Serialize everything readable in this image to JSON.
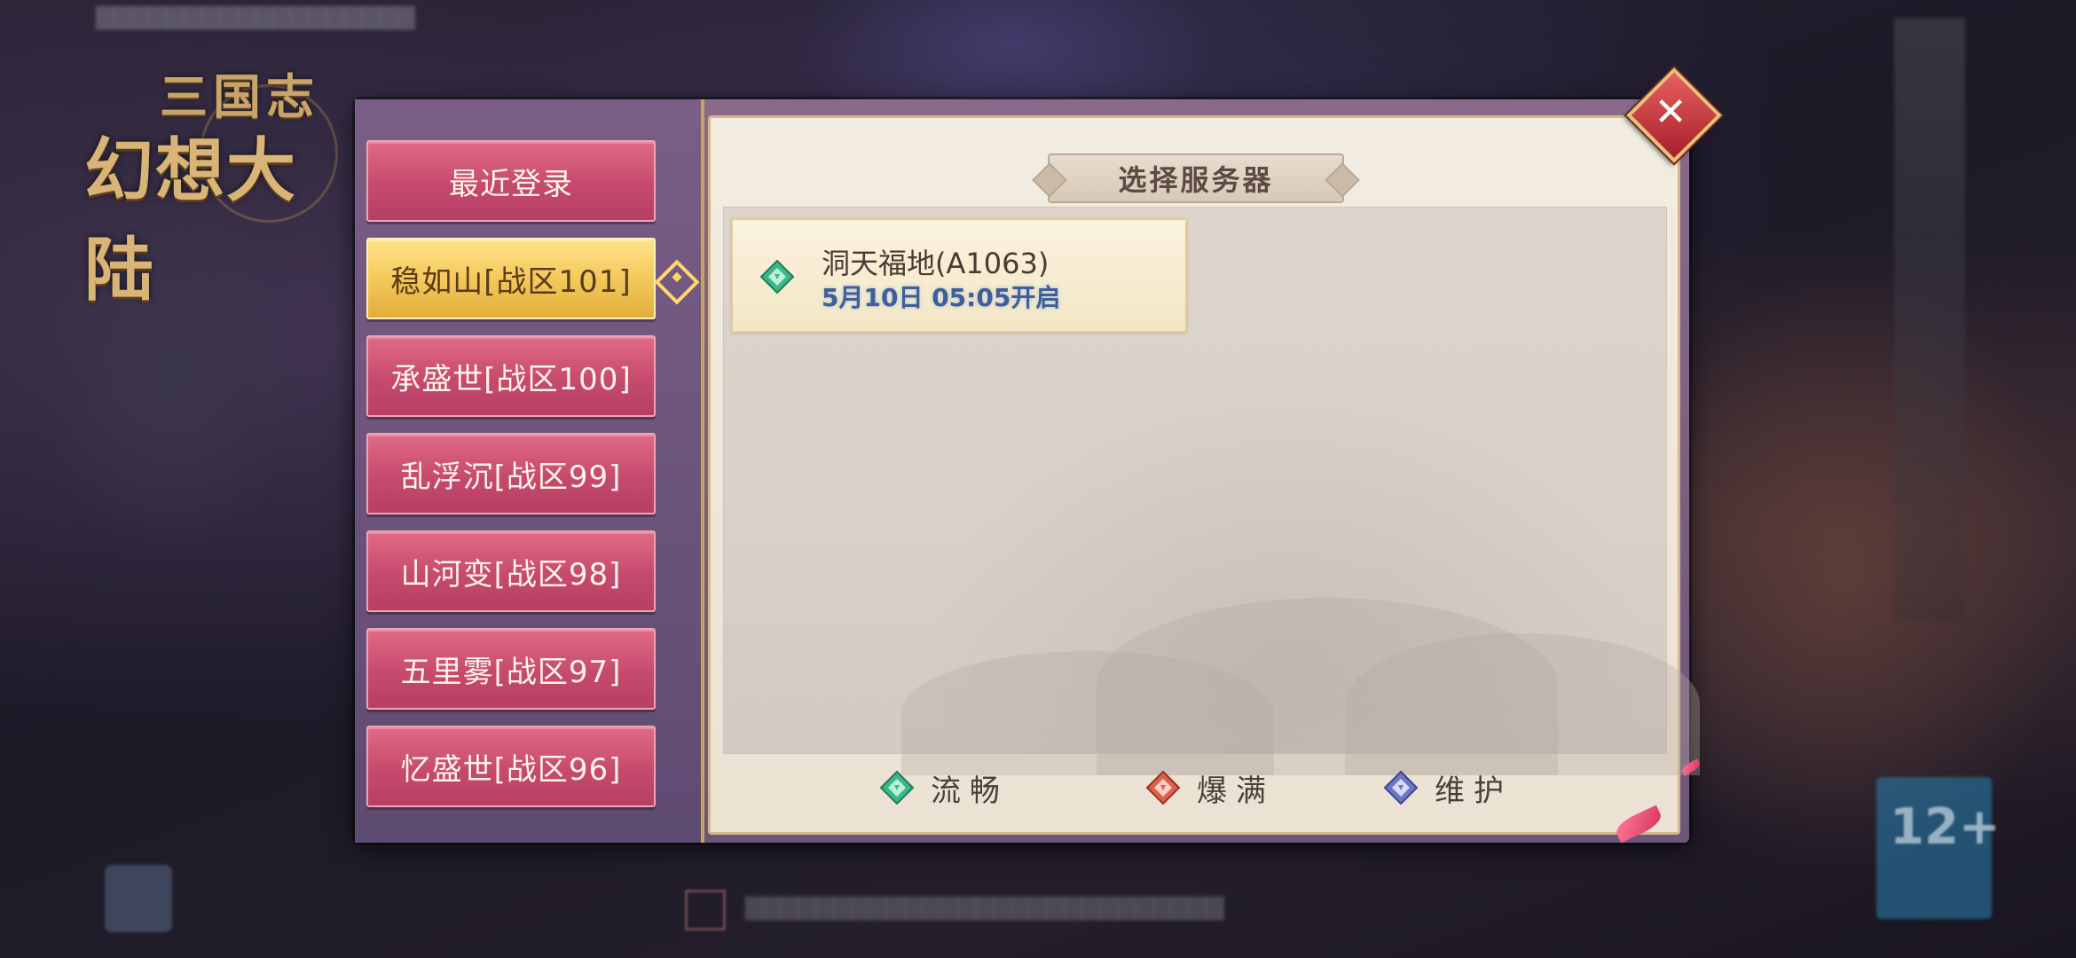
{
  "background": {
    "logo_line1": "三国志",
    "logo_line2": "幻想大陆",
    "age_rating": "12+"
  },
  "dialog": {
    "title": "选择服务器",
    "close_icon": "close-icon",
    "tabs": [
      {
        "label": "最近登录",
        "active": false
      },
      {
        "label": "稳如山[战区101]",
        "active": true
      },
      {
        "label": "承盛世[战区100]",
        "active": false
      },
      {
        "label": "乱浮沉[战区99]",
        "active": false
      },
      {
        "label": "山河变[战区98]",
        "active": false
      },
      {
        "label": "五里雾[战区97]",
        "active": false
      },
      {
        "label": "忆盛世[战区96]",
        "active": false
      }
    ],
    "servers": [
      {
        "name": "洞天福地(A1063)",
        "open_time": "5月10日 05:05开启",
        "status": "smooth"
      }
    ],
    "legend": [
      {
        "label": "流畅",
        "color": "#3bb88a",
        "icon": "green-gem-icon"
      },
      {
        "label": "爆满",
        "color": "#e0604a",
        "icon": "red-gem-icon"
      },
      {
        "label": "维护",
        "color": "#6b78c8",
        "icon": "blue-gem-icon"
      }
    ]
  },
  "colors": {
    "tab_bg": "#c64a6e",
    "tab_active_bg": "#f3c95b",
    "panel_bg": "#f3ece1",
    "accent_gold": "#c9a25d"
  }
}
